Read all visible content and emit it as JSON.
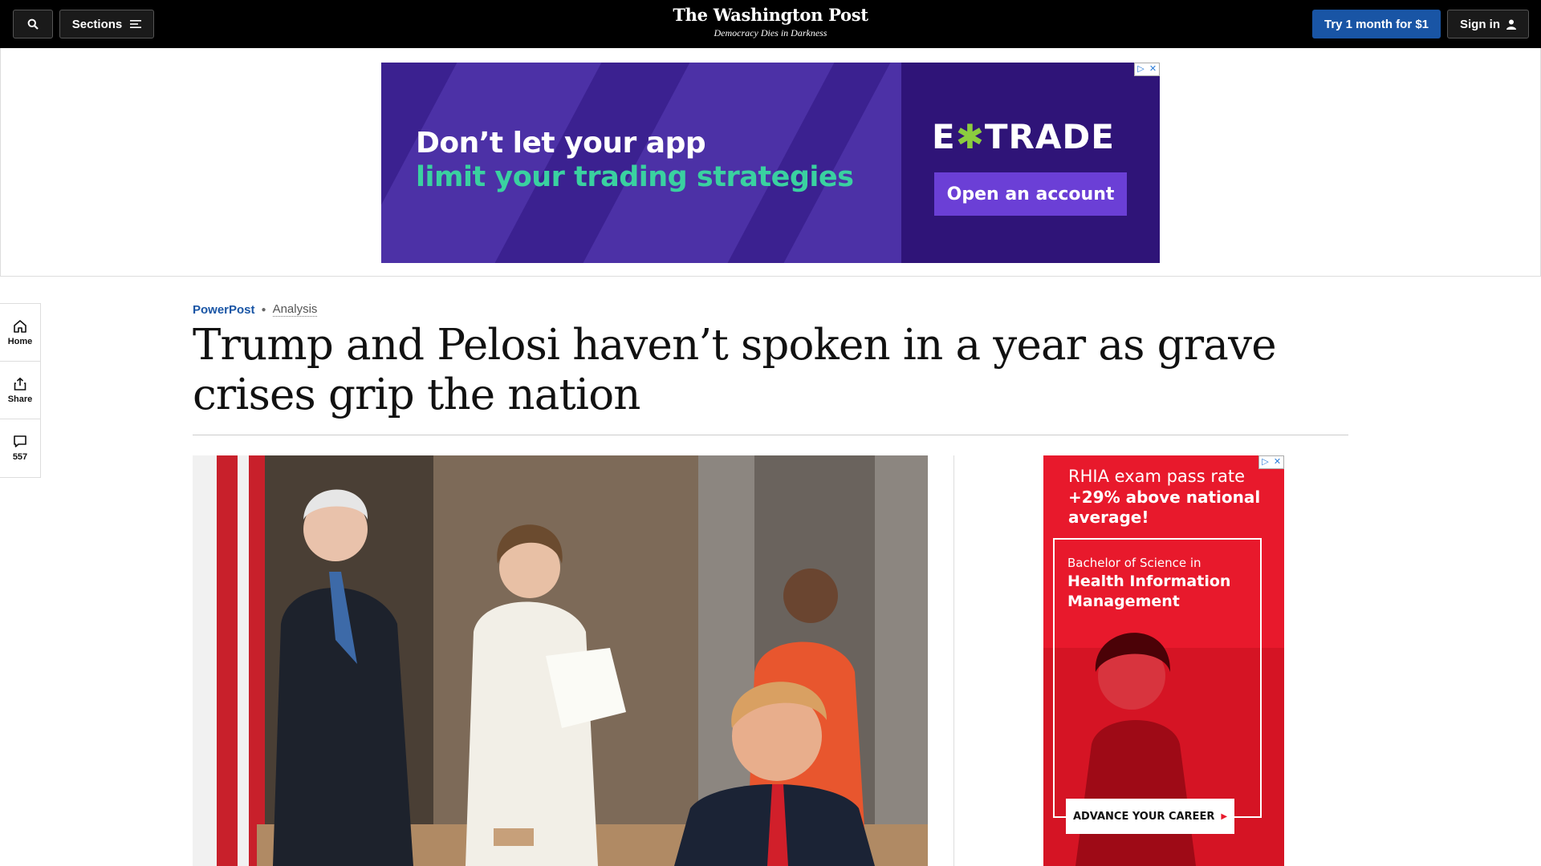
{
  "topnav": {
    "sections_label": "Sections",
    "logo": "The Washington Post",
    "tagline": "Democracy Dies in Darkness",
    "trial_label": "Try 1 month for $1",
    "signin_label": "Sign in"
  },
  "banner_ad": {
    "line1": "Don’t let your app",
    "line2": "limit your trading strategies",
    "brand_left": "E",
    "brand_x": "✱",
    "brand_right": "TRADE",
    "cta": "Open an account",
    "colors": {
      "background": "#3b2190",
      "accent_text": "#3ad1a0",
      "cta": "#6b3fd6"
    }
  },
  "rail": {
    "home_label": "Home",
    "share_label": "Share",
    "comments_count": "557"
  },
  "article": {
    "section": "PowerPost",
    "label": "Analysis",
    "headline": "Trump and Pelosi haven’t spoken in a year as grave crises grip the nation"
  },
  "side_ad": {
    "line1": "RHIA exam pass rate",
    "line2": "+29% above national average!",
    "line3": "Bachelor of Science in",
    "line4": "Health Information Management",
    "cta": "ADVANCE YOUR CAREER",
    "colors": {
      "background": "#e8192c"
    }
  },
  "colors": {
    "brand_blue": "#1955a5",
    "nav_bg": "#000000"
  }
}
